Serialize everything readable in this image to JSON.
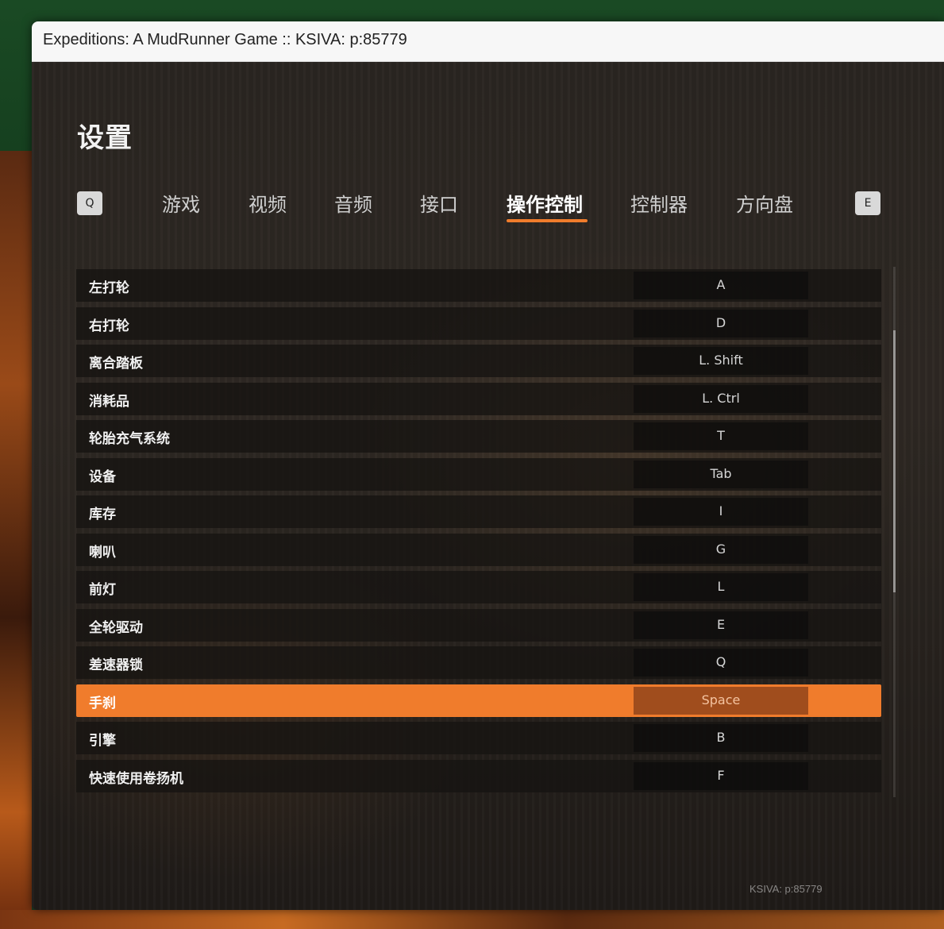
{
  "window": {
    "title": "Expeditions: A MudRunner Game :: KSIVA: p:85779"
  },
  "settings": {
    "title": "设置",
    "prev_key": "Q",
    "next_key": "E",
    "tabs": [
      {
        "label": "游戏",
        "active": false
      },
      {
        "label": "视频",
        "active": false
      },
      {
        "label": "音频",
        "active": false
      },
      {
        "label": "接口",
        "active": false
      },
      {
        "label": "操作控制",
        "active": true
      },
      {
        "label": "控制器",
        "active": false
      },
      {
        "label": "方向盘",
        "active": false
      }
    ],
    "bindings": [
      {
        "action": "左打轮",
        "key": "A"
      },
      {
        "action": "右打轮",
        "key": "D"
      },
      {
        "action": "离合踏板",
        "key": "L. Shift"
      },
      {
        "action": "消耗品",
        "key": "L. Ctrl"
      },
      {
        "action": "轮胎充气系统",
        "key": "T"
      },
      {
        "action": "设备",
        "key": "Tab"
      },
      {
        "action": "库存",
        "key": "I"
      },
      {
        "action": "喇叭",
        "key": "G"
      },
      {
        "action": "前灯",
        "key": "L"
      },
      {
        "action": "全轮驱动",
        "key": "E"
      },
      {
        "action": "差速器锁",
        "key": "Q"
      },
      {
        "action": "手刹",
        "key": "Space",
        "selected": true
      },
      {
        "action": "引擎",
        "key": "B"
      },
      {
        "action": "快速使用卷扬机",
        "key": "F"
      }
    ],
    "watermark": "KSIVA: p:85779"
  },
  "colors": {
    "accent": "#f07c2c",
    "selected_key_bg": "#a04d1d"
  }
}
